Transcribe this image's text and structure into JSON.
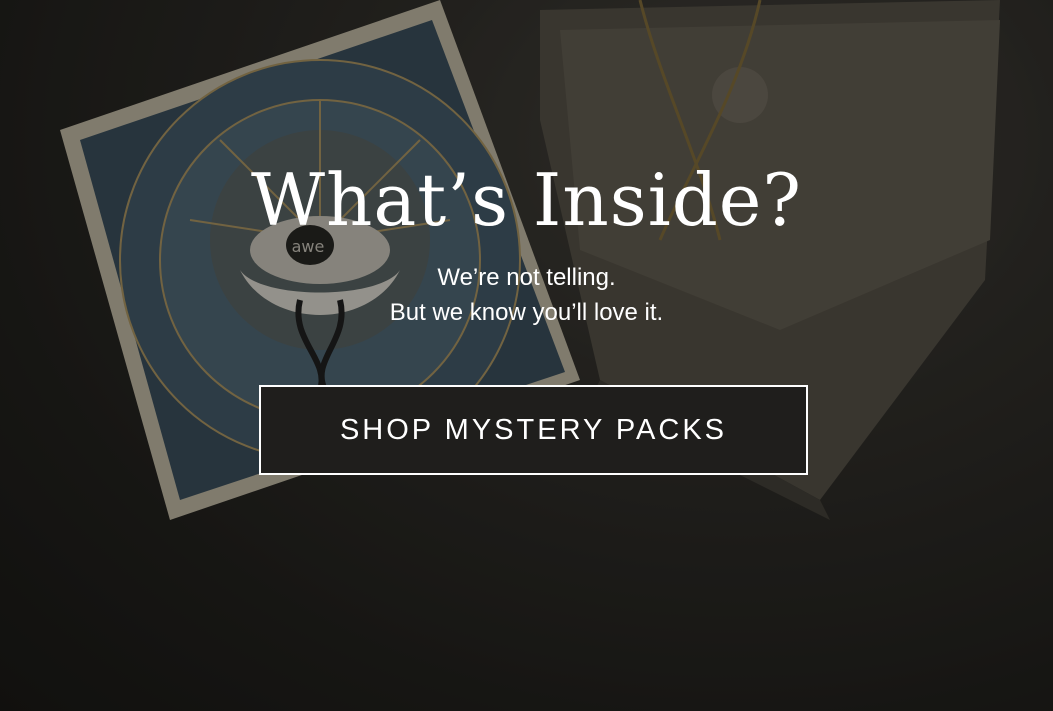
{
  "hero": {
    "title": "What’s Inside?",
    "subtitle_line1": "We’re not telling.",
    "subtitle_line2": "But we know you’ll love it.",
    "cta_label": "SHOP MYSTERY PACKS",
    "box_logo_text": "awe"
  },
  "colors": {
    "overlay": "#000000",
    "text": "#ffffff",
    "button_bg": "#1f1e1c",
    "box_art_blue": "#4a6272",
    "gold": "#b8a06a"
  }
}
